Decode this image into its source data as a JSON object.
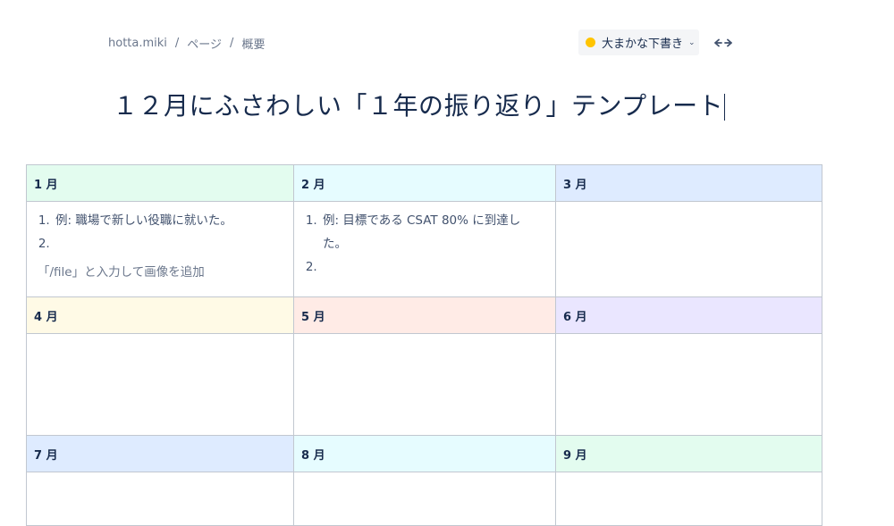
{
  "breadcrumb": {
    "items": [
      "hotta.miki",
      "ページ",
      "概要"
    ],
    "separator": "/"
  },
  "status": {
    "label": "大まかな下書き",
    "dot_color": "#FFC400"
  },
  "width_toggle": {
    "icon": "expand-width-icon"
  },
  "page": {
    "title": "１２月にふさわしい「１年の振り返り」テンプレート"
  },
  "months": [
    {
      "label": "1 月",
      "bg": "#E3FCEF",
      "items": [
        "例: 職場で新しい役職に就いた。",
        ""
      ],
      "hint": "「/file」と入力して画像を追加"
    },
    {
      "label": "2 月",
      "bg": "#E6FCFF",
      "items": [
        "例: 目標である CSAT 80% に到達した。",
        ""
      ],
      "hint": ""
    },
    {
      "label": "3 月",
      "bg": "#DEEBFF",
      "items": [],
      "hint": ""
    },
    {
      "label": "4 月",
      "bg": "#FFFAE6",
      "items": [],
      "hint": ""
    },
    {
      "label": "5 月",
      "bg": "#FFEBE6",
      "items": [],
      "hint": ""
    },
    {
      "label": "6 月",
      "bg": "#EAE6FF",
      "items": [],
      "hint": ""
    },
    {
      "label": "7 月",
      "bg": "#DEEBFF",
      "items": [],
      "hint": ""
    },
    {
      "label": "8 月",
      "bg": "#E6FCFF",
      "items": [],
      "hint": ""
    },
    {
      "label": "9 月",
      "bg": "#E3FCEF",
      "items": [],
      "hint": ""
    }
  ]
}
